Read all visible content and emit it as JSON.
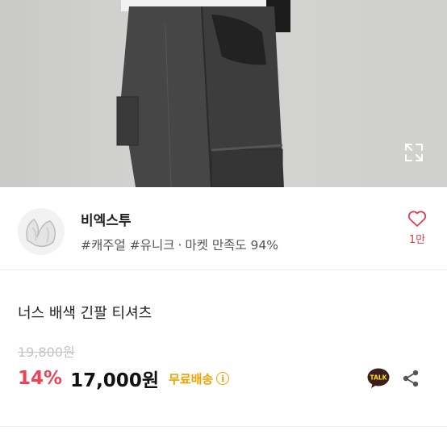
{
  "product_photo": {
    "alt_icon": "expand-icon"
  },
  "seller": {
    "name": "비엑스투",
    "tags": "#캐주얼 #유니크",
    "separator": "·",
    "satisfaction": "마켓 만족도 94%",
    "likes": "1만",
    "like_icon": "heart-outline-icon"
  },
  "product": {
    "title": "너스 배색 긴팔 티셔츠",
    "original_price": "19,800원",
    "discount": "14%",
    "sale_price": "17,000원",
    "shipping": "무료배송",
    "info_icon": "i"
  },
  "actions": {
    "talk_label": "TALK",
    "share_icon": "share-icon"
  },
  "colors": {
    "discount": "#ef4255",
    "shipping": "#f2a200",
    "like": "#e53950",
    "talk_bg": "#3c1e1e",
    "talk_bubble": "#fae100"
  }
}
